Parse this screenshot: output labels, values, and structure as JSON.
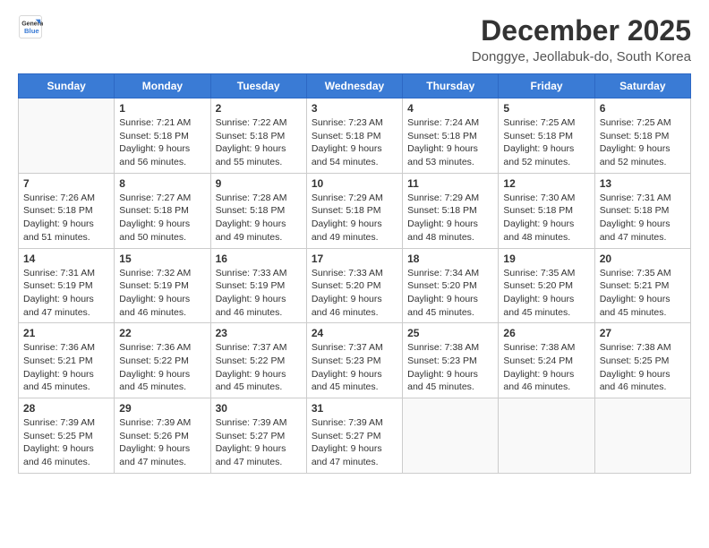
{
  "logo": {
    "text1": "General",
    "text2": "Blue"
  },
  "header": {
    "title": "December 2025",
    "subtitle": "Donggye, Jeollabuk-do, South Korea"
  },
  "weekdays": [
    "Sunday",
    "Monday",
    "Tuesday",
    "Wednesday",
    "Thursday",
    "Friday",
    "Saturday"
  ],
  "weeks": [
    [
      {
        "day": "",
        "info": ""
      },
      {
        "day": "1",
        "info": "Sunrise: 7:21 AM\nSunset: 5:18 PM\nDaylight: 9 hours\nand 56 minutes."
      },
      {
        "day": "2",
        "info": "Sunrise: 7:22 AM\nSunset: 5:18 PM\nDaylight: 9 hours\nand 55 minutes."
      },
      {
        "day": "3",
        "info": "Sunrise: 7:23 AM\nSunset: 5:18 PM\nDaylight: 9 hours\nand 54 minutes."
      },
      {
        "day": "4",
        "info": "Sunrise: 7:24 AM\nSunset: 5:18 PM\nDaylight: 9 hours\nand 53 minutes."
      },
      {
        "day": "5",
        "info": "Sunrise: 7:25 AM\nSunset: 5:18 PM\nDaylight: 9 hours\nand 52 minutes."
      },
      {
        "day": "6",
        "info": "Sunrise: 7:25 AM\nSunset: 5:18 PM\nDaylight: 9 hours\nand 52 minutes."
      }
    ],
    [
      {
        "day": "7",
        "info": "Sunrise: 7:26 AM\nSunset: 5:18 PM\nDaylight: 9 hours\nand 51 minutes."
      },
      {
        "day": "8",
        "info": "Sunrise: 7:27 AM\nSunset: 5:18 PM\nDaylight: 9 hours\nand 50 minutes."
      },
      {
        "day": "9",
        "info": "Sunrise: 7:28 AM\nSunset: 5:18 PM\nDaylight: 9 hours\nand 49 minutes."
      },
      {
        "day": "10",
        "info": "Sunrise: 7:29 AM\nSunset: 5:18 PM\nDaylight: 9 hours\nand 49 minutes."
      },
      {
        "day": "11",
        "info": "Sunrise: 7:29 AM\nSunset: 5:18 PM\nDaylight: 9 hours\nand 48 minutes."
      },
      {
        "day": "12",
        "info": "Sunrise: 7:30 AM\nSunset: 5:18 PM\nDaylight: 9 hours\nand 48 minutes."
      },
      {
        "day": "13",
        "info": "Sunrise: 7:31 AM\nSunset: 5:18 PM\nDaylight: 9 hours\nand 47 minutes."
      }
    ],
    [
      {
        "day": "14",
        "info": "Sunrise: 7:31 AM\nSunset: 5:19 PM\nDaylight: 9 hours\nand 47 minutes."
      },
      {
        "day": "15",
        "info": "Sunrise: 7:32 AM\nSunset: 5:19 PM\nDaylight: 9 hours\nand 46 minutes."
      },
      {
        "day": "16",
        "info": "Sunrise: 7:33 AM\nSunset: 5:19 PM\nDaylight: 9 hours\nand 46 minutes."
      },
      {
        "day": "17",
        "info": "Sunrise: 7:33 AM\nSunset: 5:20 PM\nDaylight: 9 hours\nand 46 minutes."
      },
      {
        "day": "18",
        "info": "Sunrise: 7:34 AM\nSunset: 5:20 PM\nDaylight: 9 hours\nand 45 minutes."
      },
      {
        "day": "19",
        "info": "Sunrise: 7:35 AM\nSunset: 5:20 PM\nDaylight: 9 hours\nand 45 minutes."
      },
      {
        "day": "20",
        "info": "Sunrise: 7:35 AM\nSunset: 5:21 PM\nDaylight: 9 hours\nand 45 minutes."
      }
    ],
    [
      {
        "day": "21",
        "info": "Sunrise: 7:36 AM\nSunset: 5:21 PM\nDaylight: 9 hours\nand 45 minutes."
      },
      {
        "day": "22",
        "info": "Sunrise: 7:36 AM\nSunset: 5:22 PM\nDaylight: 9 hours\nand 45 minutes."
      },
      {
        "day": "23",
        "info": "Sunrise: 7:37 AM\nSunset: 5:22 PM\nDaylight: 9 hours\nand 45 minutes."
      },
      {
        "day": "24",
        "info": "Sunrise: 7:37 AM\nSunset: 5:23 PM\nDaylight: 9 hours\nand 45 minutes."
      },
      {
        "day": "25",
        "info": "Sunrise: 7:38 AM\nSunset: 5:23 PM\nDaylight: 9 hours\nand 45 minutes."
      },
      {
        "day": "26",
        "info": "Sunrise: 7:38 AM\nSunset: 5:24 PM\nDaylight: 9 hours\nand 46 minutes."
      },
      {
        "day": "27",
        "info": "Sunrise: 7:38 AM\nSunset: 5:25 PM\nDaylight: 9 hours\nand 46 minutes."
      }
    ],
    [
      {
        "day": "28",
        "info": "Sunrise: 7:39 AM\nSunset: 5:25 PM\nDaylight: 9 hours\nand 46 minutes."
      },
      {
        "day": "29",
        "info": "Sunrise: 7:39 AM\nSunset: 5:26 PM\nDaylight: 9 hours\nand 47 minutes."
      },
      {
        "day": "30",
        "info": "Sunrise: 7:39 AM\nSunset: 5:27 PM\nDaylight: 9 hours\nand 47 minutes."
      },
      {
        "day": "31",
        "info": "Sunrise: 7:39 AM\nSunset: 5:27 PM\nDaylight: 9 hours\nand 47 minutes."
      },
      {
        "day": "",
        "info": ""
      },
      {
        "day": "",
        "info": ""
      },
      {
        "day": "",
        "info": ""
      }
    ]
  ]
}
